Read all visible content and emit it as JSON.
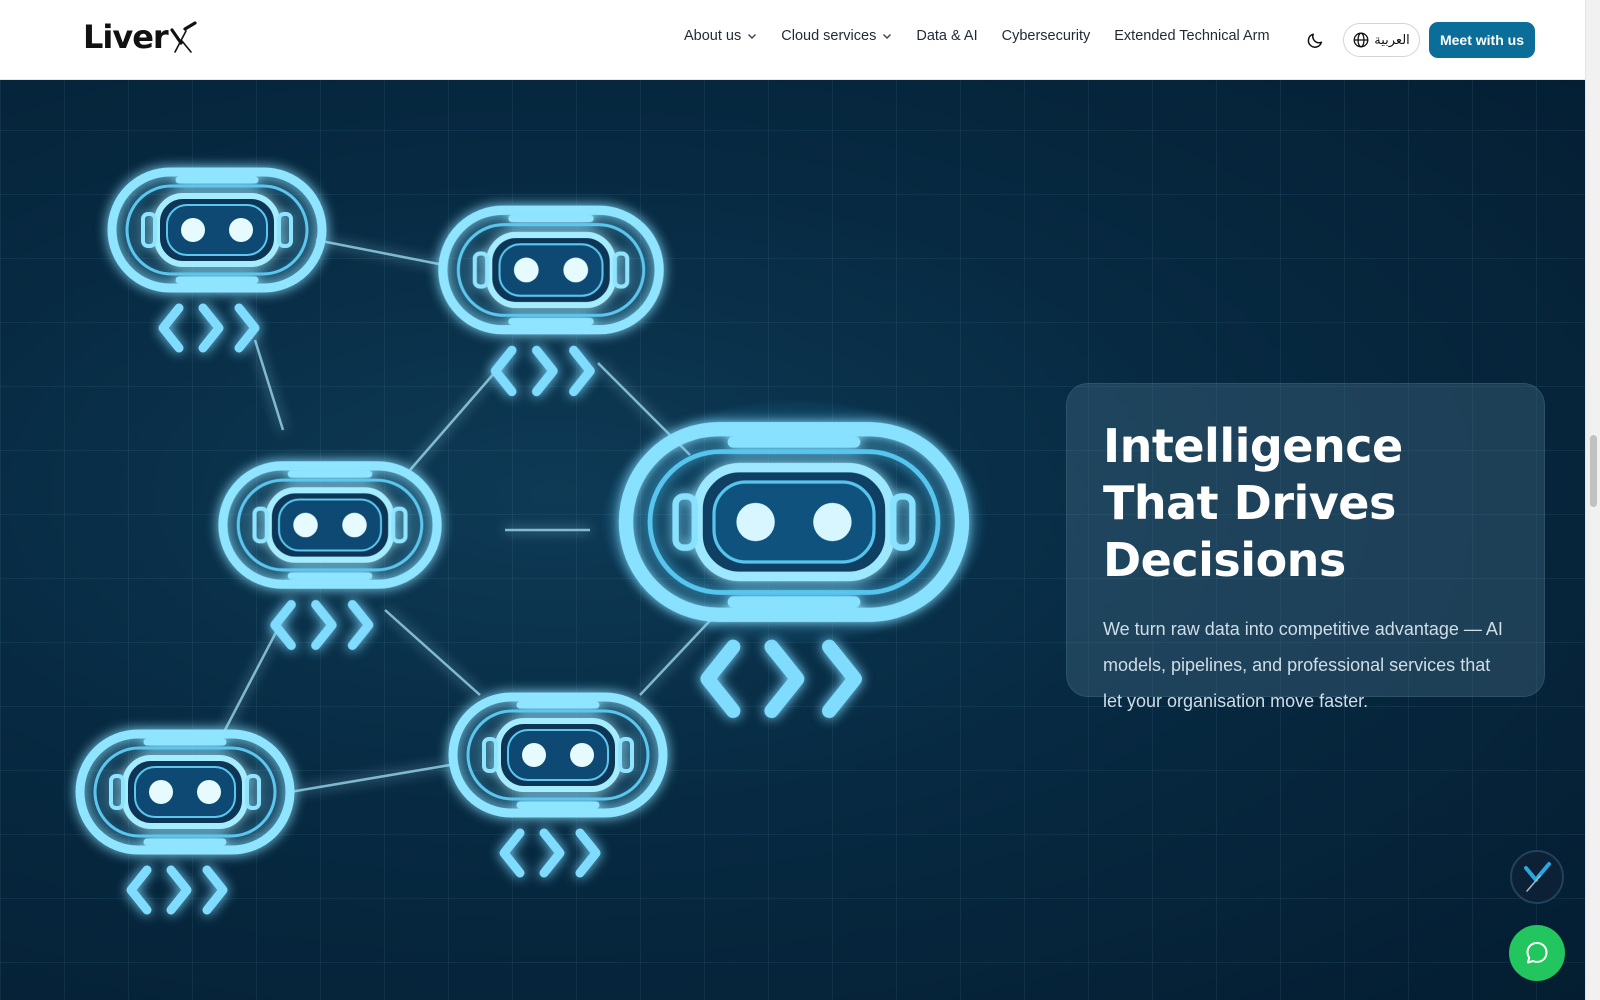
{
  "brand": {
    "logo_text": "Liver"
  },
  "nav": {
    "items": [
      {
        "label": "About us",
        "has_dropdown": true
      },
      {
        "label": "Cloud services",
        "has_dropdown": true
      },
      {
        "label": "Data & AI",
        "has_dropdown": false
      },
      {
        "label": "Cybersecurity",
        "has_dropdown": false
      },
      {
        "label": "Extended Technical Arm",
        "has_dropdown": false
      }
    ],
    "theme_icon": "moon-icon",
    "language_label": "العربية",
    "language_icon": "globe-icon",
    "cta_label": "Meet with us"
  },
  "hero": {
    "title": "Intelligence That Drives Decisions",
    "text": "We turn raw data into competitive advantage — AI models, pipelines, and professional services that let your organisation move faster."
  },
  "floating": {
    "assistant_icon": "liverx-assistant-icon",
    "chat_icon": "chat-bubble-icon"
  },
  "colors": {
    "accent": "#0b6e99",
    "chat_green": "#22c55e",
    "hero_bg": "#072a42",
    "glow": "#7fe0ff"
  }
}
